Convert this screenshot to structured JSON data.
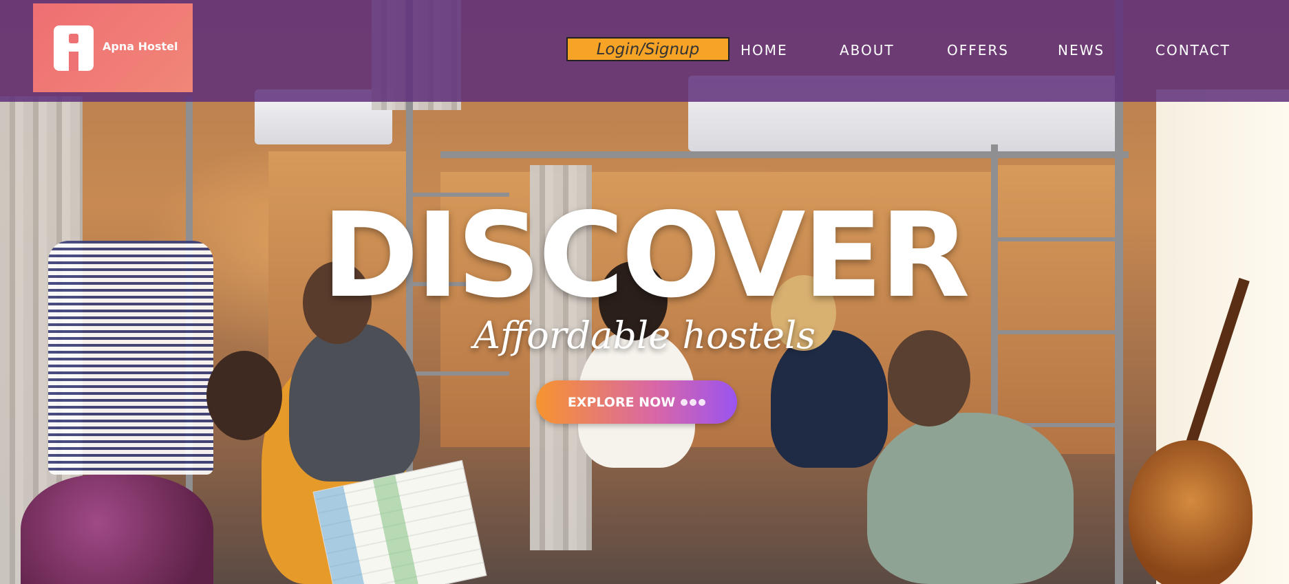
{
  "brand": {
    "name": "Apna Hostel",
    "logo_icon": "letter-a-icon"
  },
  "header": {
    "login_label": "Login/Signup",
    "nav": [
      {
        "id": "home",
        "label": "HOME"
      },
      {
        "id": "about",
        "label": "ABOUT"
      },
      {
        "id": "offers",
        "label": "OFFERS"
      },
      {
        "id": "news",
        "label": "NEWS"
      },
      {
        "id": "contact",
        "label": "CONTACT"
      }
    ]
  },
  "hero": {
    "title": "DISCOVER",
    "subtitle": "Affordable hostels",
    "cta_label": "EXPLORE NOW",
    "cta_icon": "dots-icon"
  },
  "colors": {
    "header_overlay": "#5f307a",
    "logo_bg": "#ef6f72",
    "login_bg": "#f7a326",
    "cta_gradient_start": "#f7942f",
    "cta_gradient_end": "#9a54f0"
  }
}
